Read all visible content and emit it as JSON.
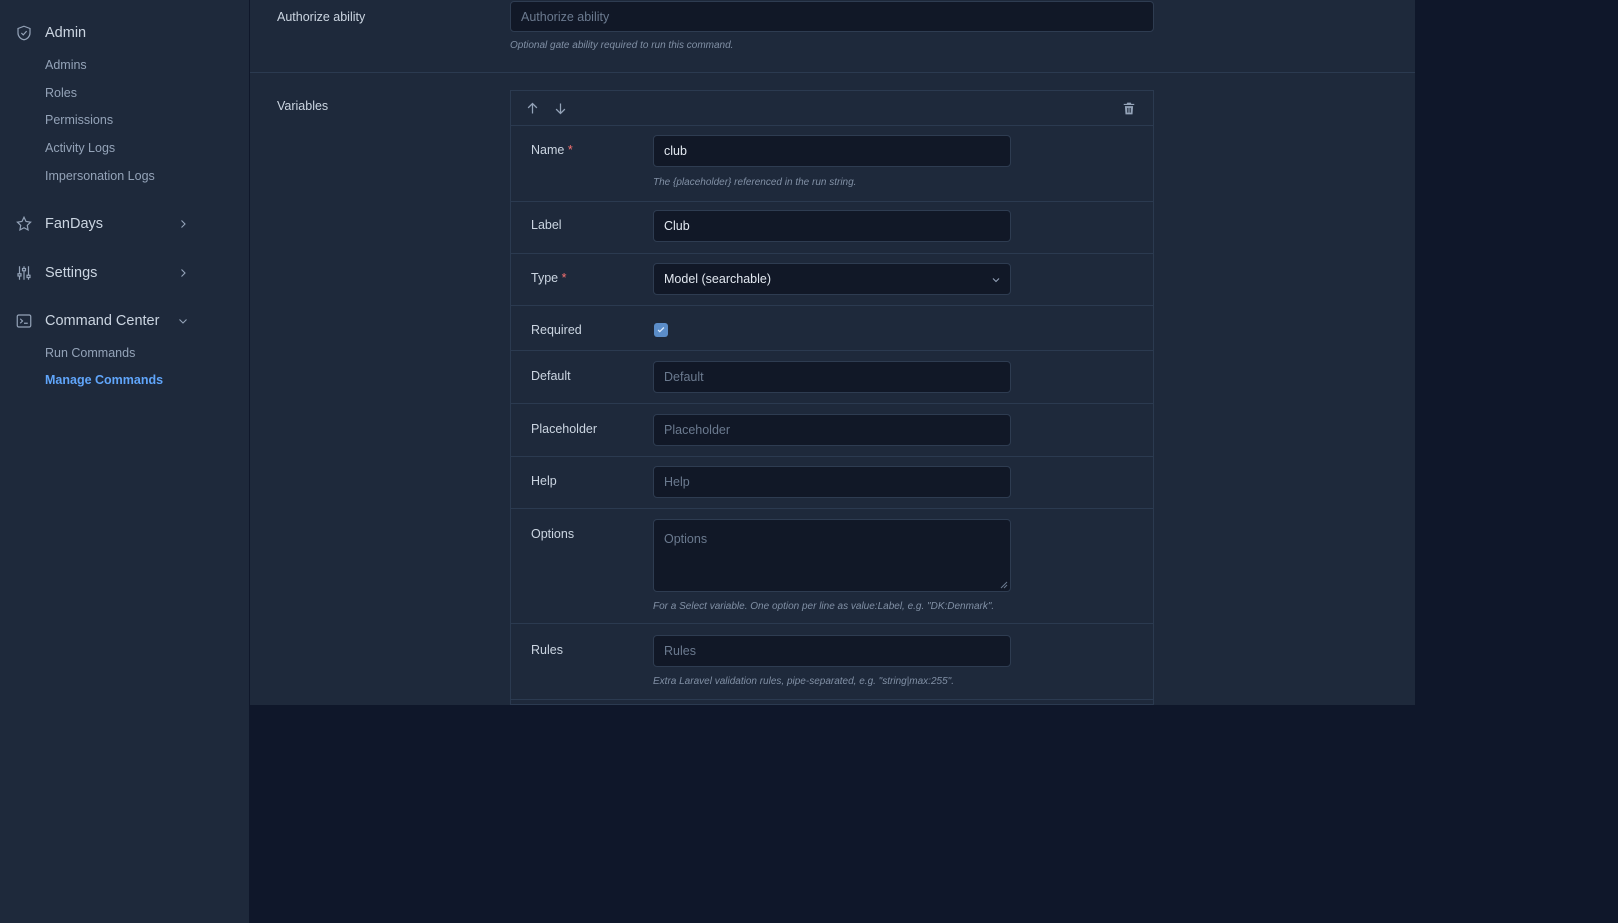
{
  "sidebar": {
    "admin_group": {
      "label": "Admin",
      "icon": "shield-icon",
      "items": [
        "Admins",
        "Roles",
        "Permissions",
        "Activity Logs",
        "Impersonation Logs"
      ]
    },
    "fandays_group": {
      "label": "FanDays",
      "icon": "star-icon"
    },
    "settings_group": {
      "label": "Settings",
      "icon": "sliders-icon"
    },
    "command_group": {
      "label": "Command Center",
      "icon": "terminal-icon",
      "items": [
        "Run Commands",
        "Manage Commands"
      ],
      "active_item": "Manage Commands"
    }
  },
  "form": {
    "authorize": {
      "label": "Authorize ability",
      "placeholder": "Authorize ability",
      "help": "Optional gate ability required to run this command."
    },
    "variables": {
      "label": "Variables",
      "name": {
        "label": "Name",
        "required_mark": "*",
        "value": "club",
        "help": "The {placeholder} referenced in the run string."
      },
      "label_field": {
        "label": "Label",
        "value": "Club"
      },
      "type": {
        "label": "Type",
        "required_mark": "*",
        "value": "Model (searchable)"
      },
      "required": {
        "label": "Required",
        "checked": true
      },
      "default": {
        "label": "Default",
        "placeholder": "Default"
      },
      "placeholder_field": {
        "label": "Placeholder",
        "placeholder": "Placeholder"
      },
      "help_field": {
        "label": "Help",
        "placeholder": "Help"
      },
      "options": {
        "label": "Options",
        "placeholder": "Options",
        "help": "For a Select variable. One option per line as value:Label, e.g. \"DK:Denmark\"."
      },
      "rules": {
        "label": "Rules",
        "placeholder": "Rules",
        "help": "Extra Laravel validation rules, pipe-separated, e.g. \"string|max:255\"."
      }
    }
  },
  "colors": {
    "accent": "#60a5fa",
    "sidebar_bg": "#1e293b",
    "page_bg": "#0f172a",
    "checkbox": "#5b8dc9"
  }
}
